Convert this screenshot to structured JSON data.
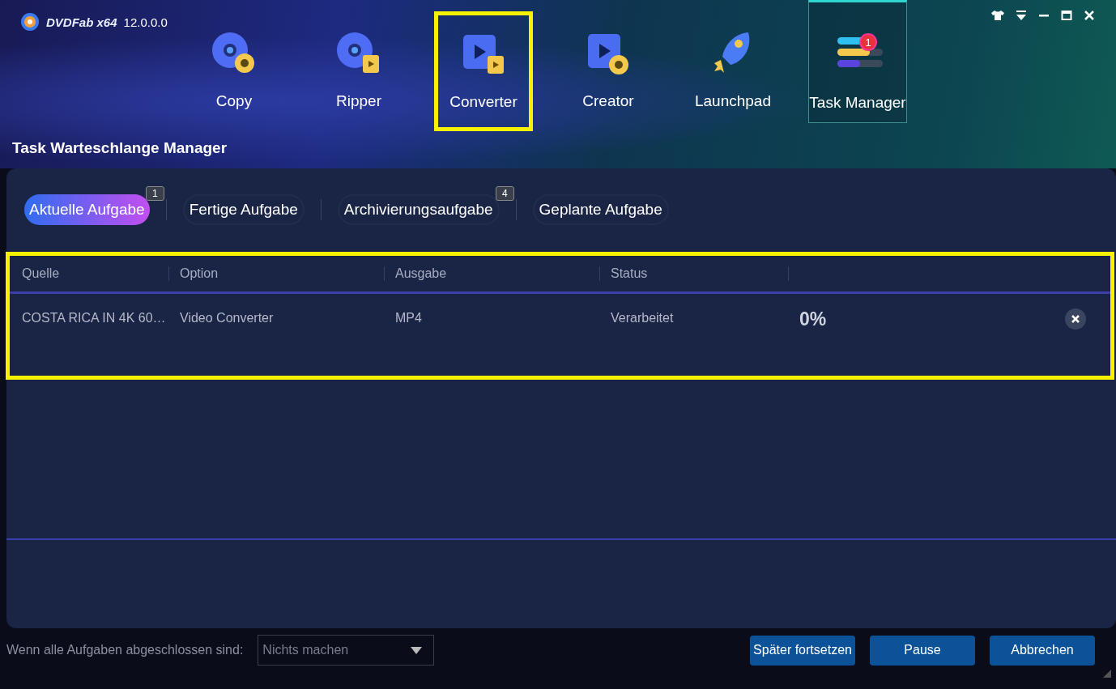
{
  "app": {
    "logo_text": "DVDFab x64",
    "version": "12.0.0.0"
  },
  "nav": [
    {
      "kind": "copy",
      "label": "Copy",
      "selected": false,
      "highlighted": false
    },
    {
      "kind": "ripper",
      "label": "Ripper",
      "selected": false,
      "highlighted": false
    },
    {
      "kind": "converter",
      "label": "Converter",
      "selected": false,
      "highlighted": true
    },
    {
      "kind": "creator",
      "label": "Creator",
      "selected": false,
      "highlighted": false
    },
    {
      "kind": "launchpad",
      "label": "Launchpad",
      "selected": false,
      "highlighted": false
    },
    {
      "kind": "tasks",
      "label": "Task Manager",
      "selected": true,
      "highlighted": false,
      "badge": "1"
    }
  ],
  "section_title": "Task Warteschlange Manager",
  "tabs": [
    {
      "label": "Aktuelle Aufgabe",
      "selected": true,
      "badge": "1"
    },
    {
      "label": "Fertige Aufgabe",
      "selected": false
    },
    {
      "label": "Archivierungsaufgabe",
      "selected": false,
      "badge": "4"
    },
    {
      "label": "Geplante Aufgabe",
      "selected": false
    }
  ],
  "table": {
    "highlighted": true,
    "columns": [
      "Quelle",
      "Option",
      "Ausgabe",
      "Status"
    ],
    "rows": [
      {
        "cells": [
          "COSTA RICA IN 4K 60…",
          "Video Converter",
          "MP4",
          "Verarbeitet"
        ],
        "progress": "0%"
      }
    ]
  },
  "footer": {
    "label": "Wenn alle Aufgaben abgeschlossen sind:",
    "dropdown_value": "Nichts machen",
    "buttons": [
      "Später fortsetzen",
      "Pause",
      "Abbrechen"
    ]
  }
}
